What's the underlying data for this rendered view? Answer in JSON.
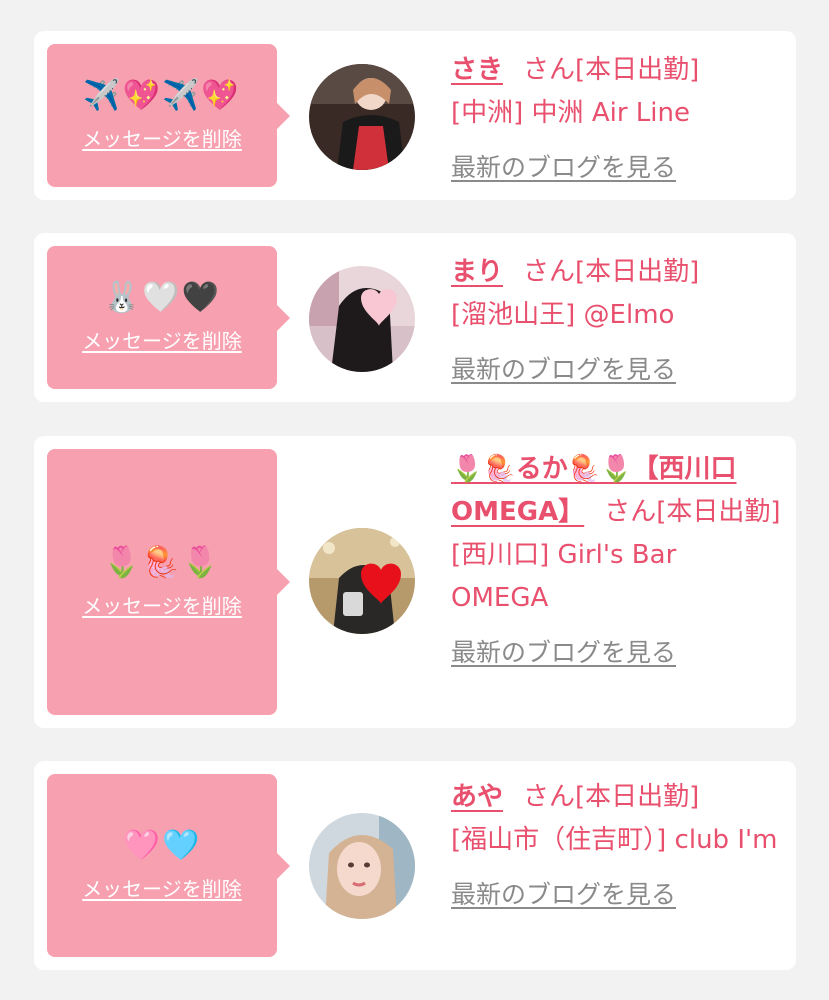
{
  "delete_label": "メッセージを削除",
  "blog_label": "最新のブログを見る",
  "honorific": "さん[本日出勤]",
  "colors": {
    "page_bg": "#f2f2f2",
    "bubble": "#f7a0af",
    "accent_text": "#e8506e",
    "link_gray": "#8a8a8a"
  },
  "items": [
    {
      "message": "✈️💖✈️💖",
      "name": "さき",
      "shop": "[中洲] 中洲 Air Line"
    },
    {
      "message": "🐰🤍🖤",
      "name": "まり",
      "shop": "[溜池山王] @Elmo"
    },
    {
      "message": "🌷🪼🌷",
      "name": "🌷🪼るか🪼🌷【西川口OMEGA】",
      "shop": "[西川口] Girl's Bar OMEGA"
    },
    {
      "message": "🩷🩵",
      "name": "あや",
      "shop": "[福山市（住吉町）] club I'm"
    }
  ]
}
